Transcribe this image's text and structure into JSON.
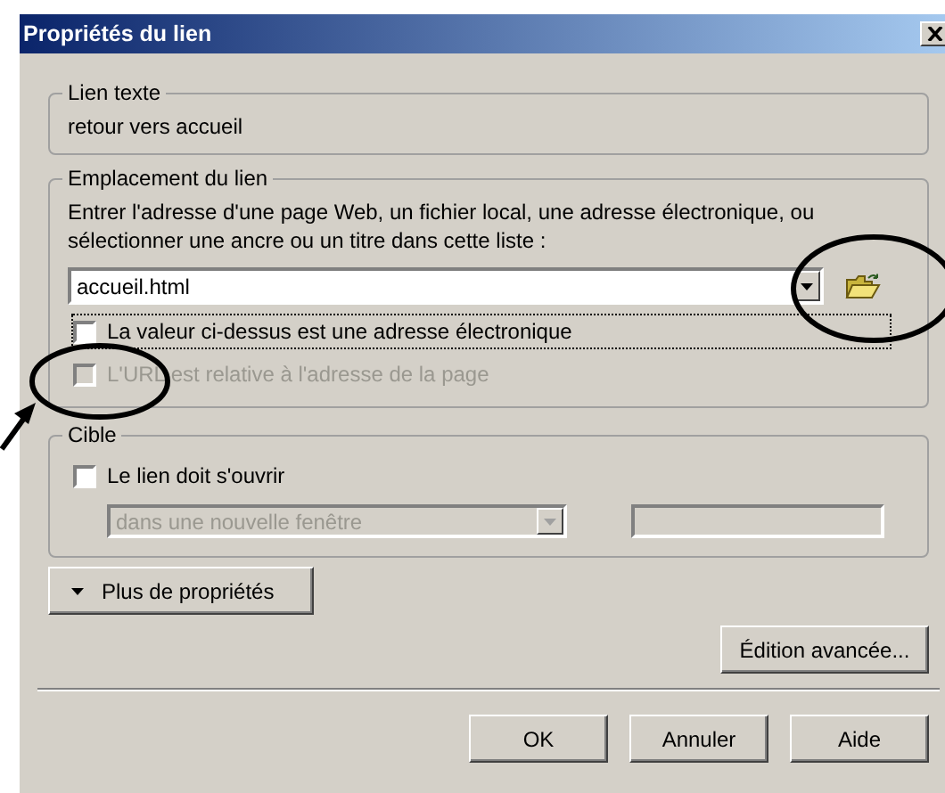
{
  "window": {
    "title": "Propriétés du lien"
  },
  "link_text": {
    "legend": "Lien texte",
    "value": "retour vers accueil"
  },
  "location": {
    "legend": "Emplacement du lien",
    "instructions": "Entrer l'adresse d'une page Web, un fichier local, une adresse électronique, ou sélectionner une ancre ou un titre dans cette liste :",
    "url": "accueil.html",
    "options": [
      {
        "label": "La valeur ci-dessus est une adresse électronique",
        "checked": false,
        "disabled": false,
        "focused": true
      },
      {
        "label": "L'URL est relative à l'adresse de la page",
        "checked": false,
        "disabled": true,
        "focused": false
      }
    ]
  },
  "target": {
    "legend": "Cible",
    "open_option": {
      "label": "Le lien doit s'ouvrir",
      "checked": false
    },
    "window_select": {
      "value": "dans une nouvelle fenêtre",
      "disabled": true
    },
    "frame_field": {
      "disabled": true
    }
  },
  "more_button": {
    "label": "Plus de propriétés",
    "expanded": false
  },
  "advanced_button": "Édition avancée...",
  "buttons": [
    "OK",
    "Annuler",
    "Aide"
  ]
}
